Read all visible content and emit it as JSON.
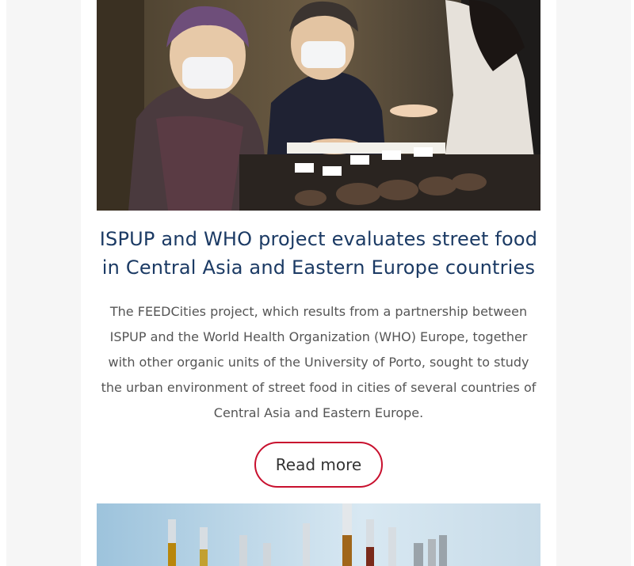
{
  "articles": [
    {
      "image": {
        "icon": "street-food-vendors-photo",
        "description_visible": false
      },
      "title": "ISPUP and WHO project evaluates street food in Central Asia and Eastern Europe countries",
      "summary": "The FEEDCities project, which results from a partnership between ISPUP and the World Health Organization (WHO) Europe, together with other organic units of the University of Porto, sought to study the urban environment of street food in cities of several countries of Central Asia and Eastern Europe.",
      "read_more_label": "Read more"
    },
    {
      "image": {
        "icon": "laboratory-vials-photo"
      }
    }
  ],
  "colors": {
    "title": "#1b3a64",
    "button_border": "#c8102e",
    "text": "#555555",
    "side_background": "#f6f6f6"
  }
}
